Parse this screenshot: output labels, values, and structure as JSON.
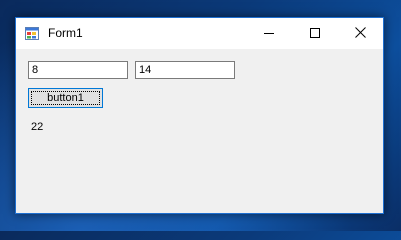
{
  "window": {
    "title": "Form1",
    "app_icon": "winforms-app-icon",
    "controls": {
      "minimize": "minimize-icon",
      "maximize": "maximize-icon",
      "close": "close-icon"
    }
  },
  "form": {
    "textbox1_value": "8",
    "textbox2_value": "14",
    "button1_label": "button1",
    "result_label": "22"
  },
  "colors": {
    "titlebar": "#ffffff",
    "window_border": "#1e6fd0",
    "client_background": "#f0f0f0",
    "button_focus_border": "#0078d7"
  }
}
